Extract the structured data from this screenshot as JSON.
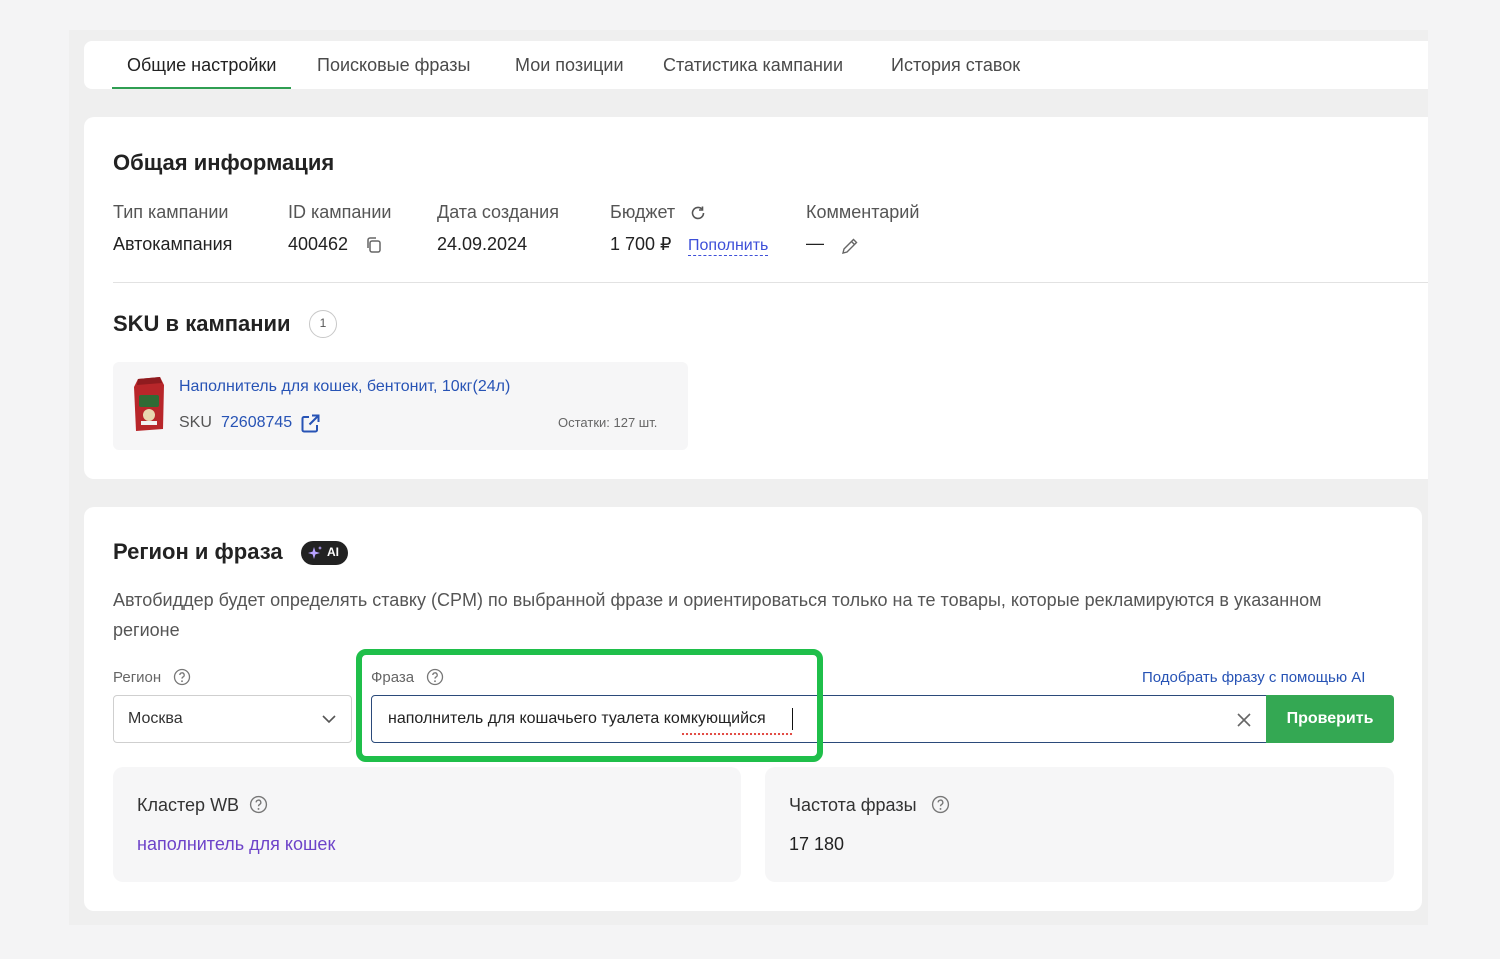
{
  "tabs": [
    {
      "label": "Общие настройки",
      "active": true
    },
    {
      "label": "Поисковые фразы"
    },
    {
      "label": "Мои позиции"
    },
    {
      "label": "Статистика кампании"
    },
    {
      "label": "История ставок"
    }
  ],
  "general": {
    "title": "Общая информация",
    "campaign_type_label": "Тип кампании",
    "campaign_type_value": "Автокампания",
    "campaign_id_label": "ID кампании",
    "campaign_id_value": "400462",
    "created_label": "Дата создания",
    "created_value": "24.09.2024",
    "budget_label": "Бюджет",
    "budget_value": "1 700 ₽",
    "topup_label": "Пополнить",
    "comment_label": "Комментарий",
    "comment_value": "—"
  },
  "sku_section": {
    "title": "SKU в кампании",
    "count": "1",
    "item": {
      "name": "Наполнитель для кошек, бентонит, 10кг(24л)",
      "sku_label": "SKU",
      "sku_number": "72608745",
      "stock": "Остатки: 127 шт."
    }
  },
  "region_phrase": {
    "title": "Регион и фраза",
    "ai_badge": "AI",
    "description": "Автобиддер будет определять ставку (CPM) по выбранной фразе и ориентироваться только на те товары, которые рекламируются в указанном регионе",
    "region_label": "Регион",
    "region_value": "Москва",
    "phrase_label": "Фраза",
    "phrase_value": "наполнитель для кошачьего туалета комкующийся",
    "ai_pick_link": "Подобрать фразу с помощью AI",
    "check_button": "Проверить",
    "cluster_label": "Кластер WB",
    "cluster_value": "наполнитель для кошек",
    "frequency_label": "Частота фразы",
    "frequency_value": "17 180"
  },
  "colors": {
    "accent_green": "#34a853",
    "highlight_green": "#1fbf4a",
    "link_blue": "#2753b5",
    "cluster_purple": "#6d43c9"
  }
}
